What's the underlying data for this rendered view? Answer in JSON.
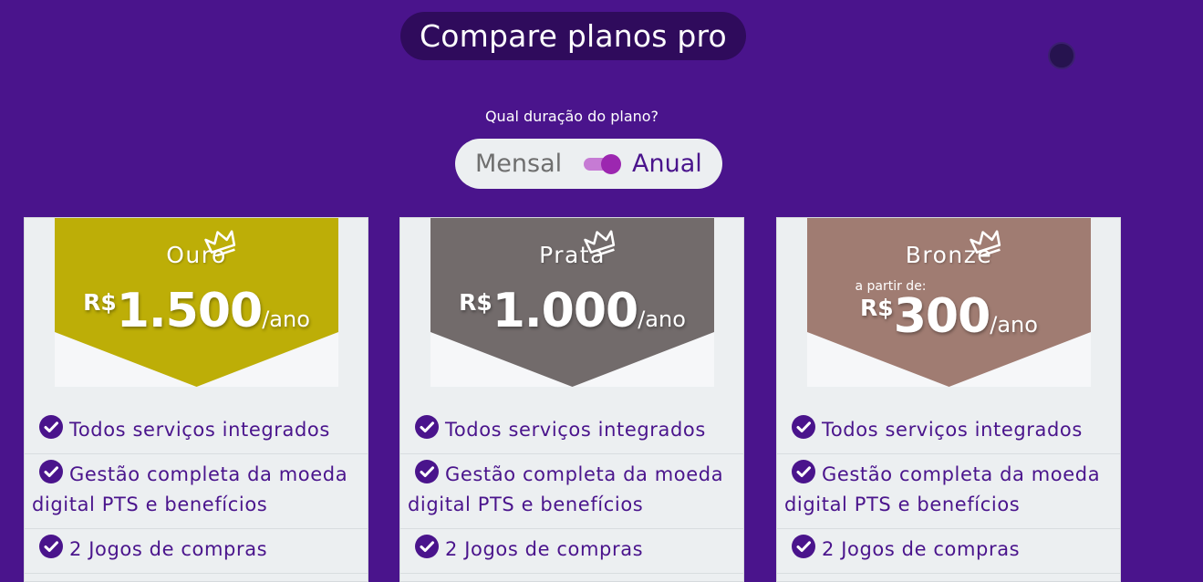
{
  "header": {
    "title": "Compare planos pro"
  },
  "duration": {
    "question": "Qual duração do plano?",
    "option_monthly": "Mensal",
    "option_annual": "Anual",
    "selected": "Anual"
  },
  "plans": [
    {
      "name": "Ouro",
      "from_label": "",
      "currency": "R$",
      "amount": "1.500",
      "period": "/ano",
      "color": "#bdae07",
      "features": [
        "Todos serviços integrados",
        "Gestão completa da moeda digital PTS e benefícios",
        "2 Jogos de compras"
      ]
    },
    {
      "name": "Prata",
      "from_label": "",
      "currency": "R$",
      "amount": "1.000",
      "period": "/ano",
      "color": "#726b6b",
      "features": [
        "Todos serviços integrados",
        "Gestão completa da moeda digital PTS e benefícios",
        "2 Jogos de compras"
      ]
    },
    {
      "name": "Bronze",
      "from_label": "a partir de:",
      "currency": "R$",
      "amount": "300",
      "period": "/ano",
      "color": "#a07c72",
      "features": [
        "Todos serviços integrados",
        "Gestão completa da moeda digital PTS e benefícios",
        "2 Jogos de compras"
      ]
    }
  ],
  "colors": {
    "background": "#4a148c",
    "accent": "#9c27b0",
    "card": "#eceff1"
  },
  "icons": {
    "crown": "crown-icon",
    "check": "check-circle-icon"
  }
}
